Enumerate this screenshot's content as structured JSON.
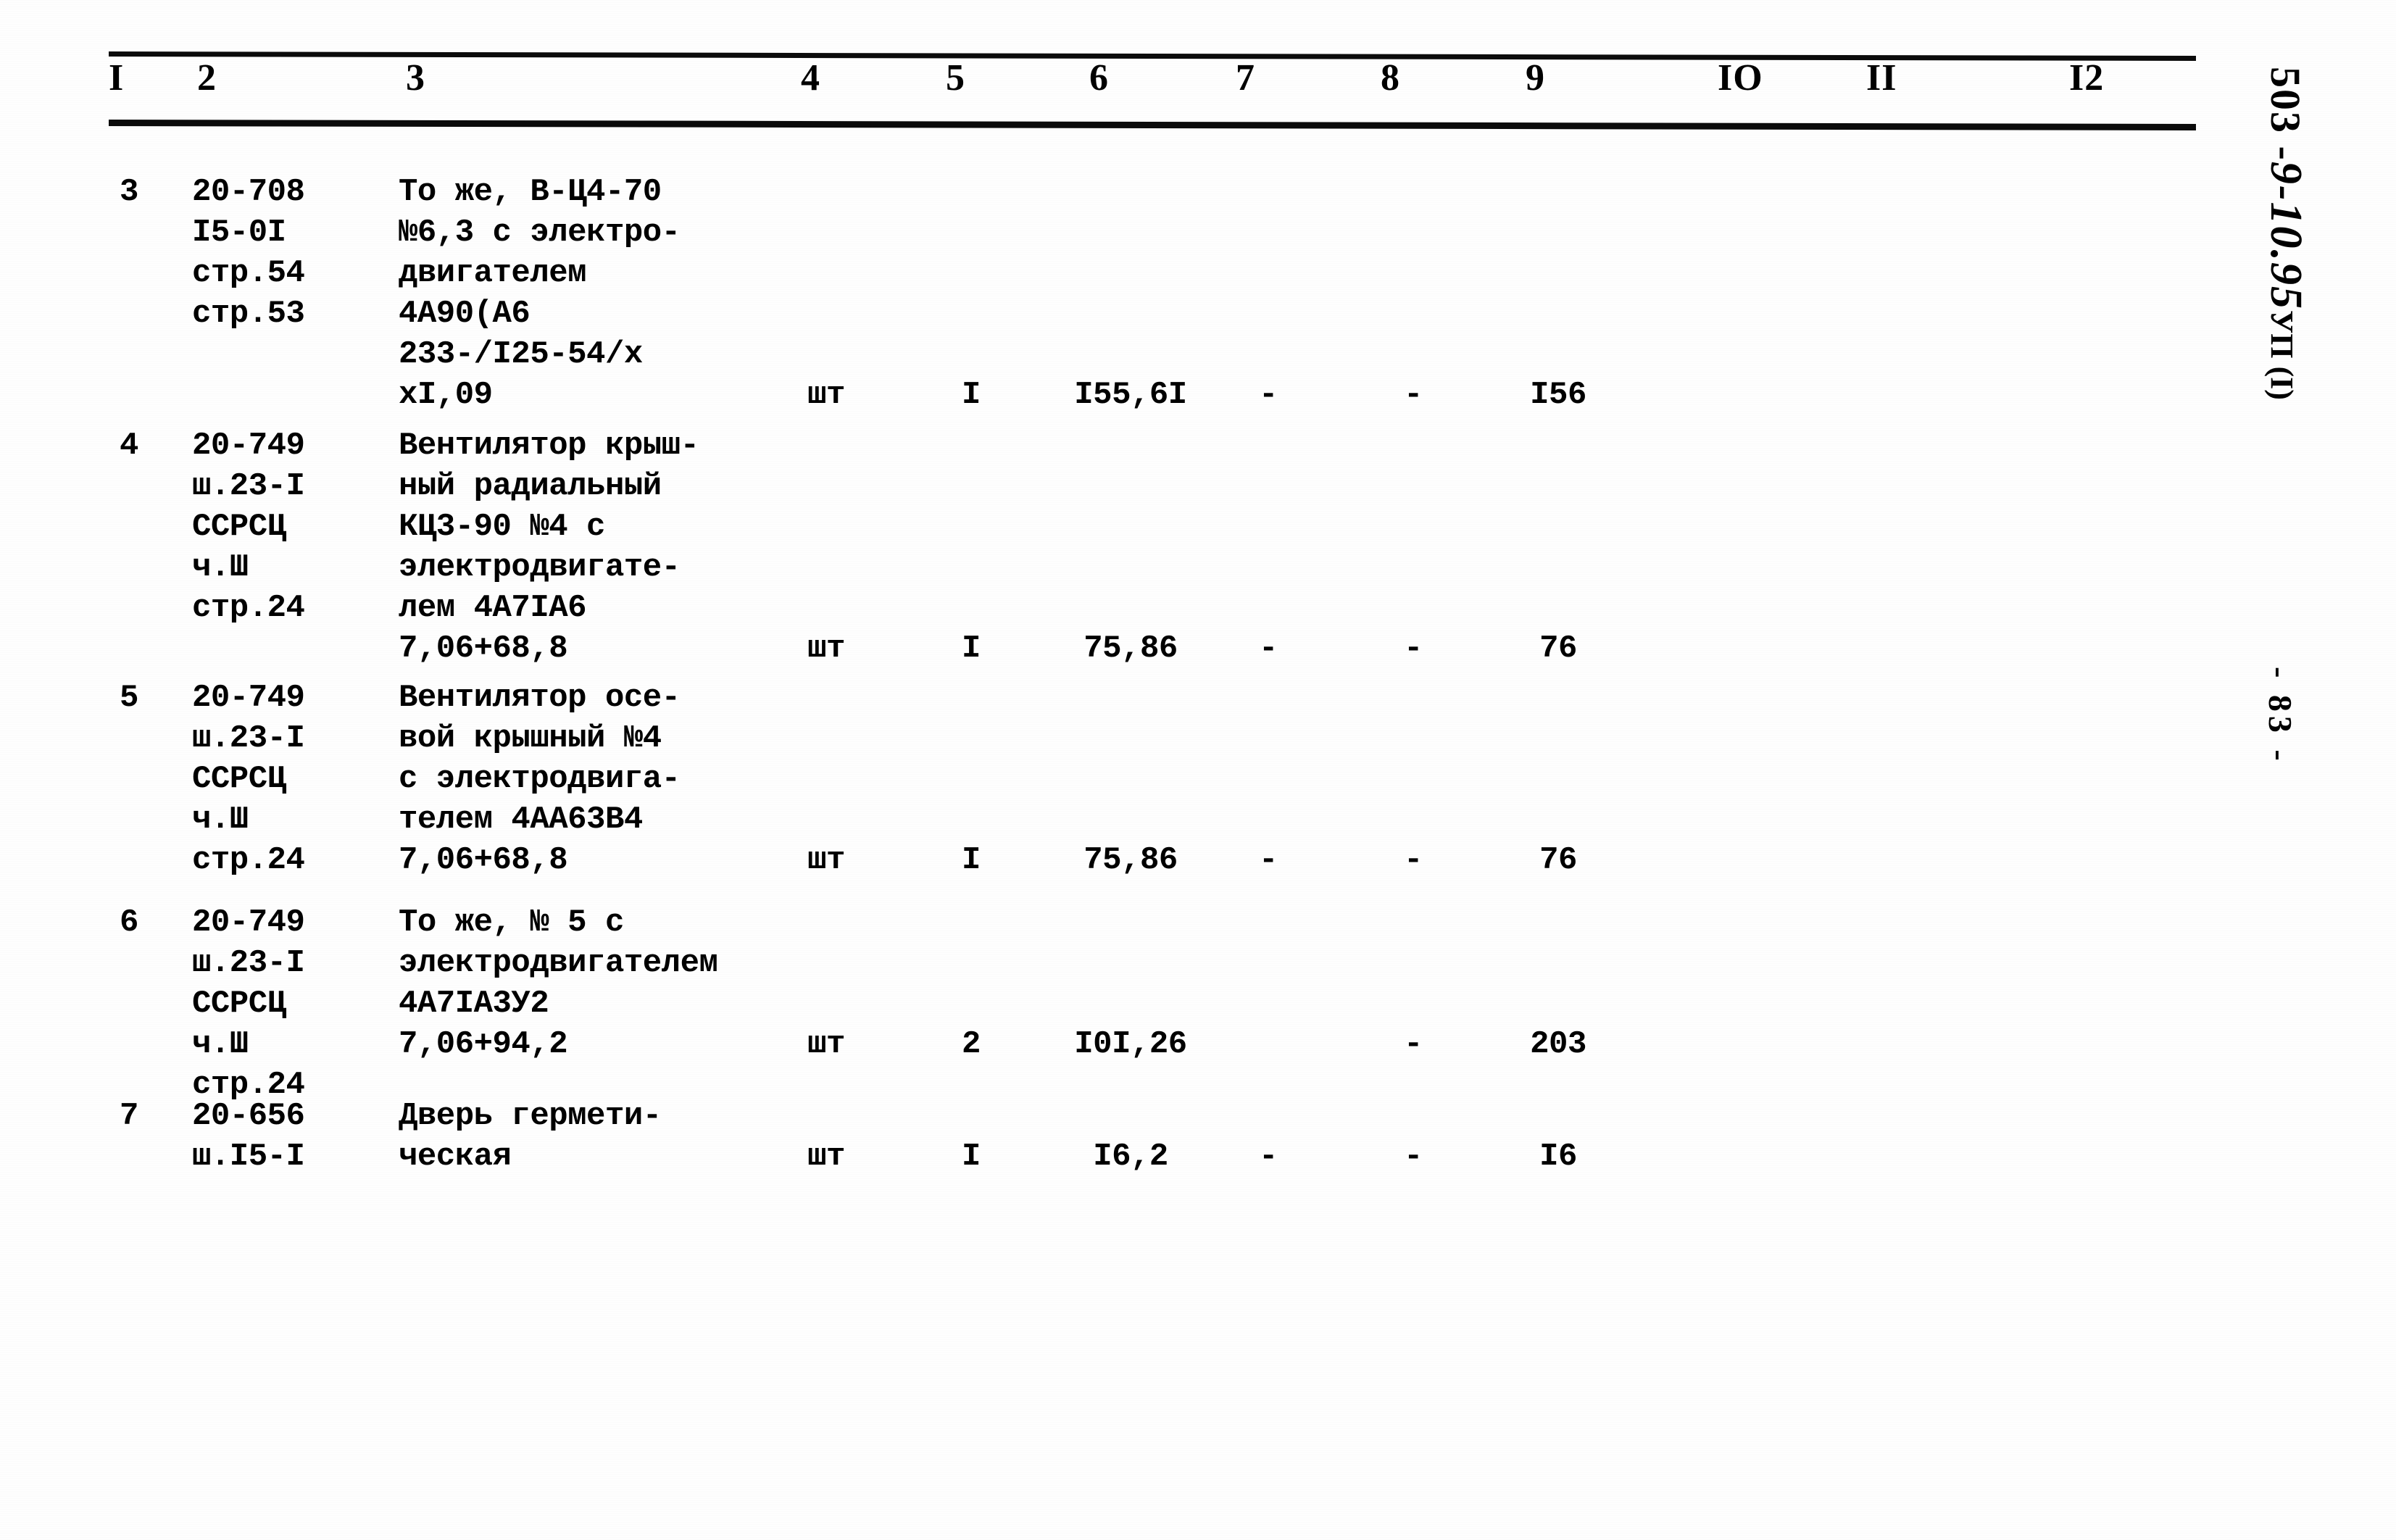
{
  "document": {
    "margin_code": "503 - 9-10.95 УП (I)",
    "margin_code_parts": {
      "prefix": "503 -",
      "italic": "9-10.95",
      "suffix": "УП (I)"
    },
    "page_marker": "- 83 -"
  },
  "table": {
    "column_headers": [
      "I",
      "2",
      "3",
      "4",
      "5",
      "6",
      "7",
      "8",
      "9",
      "IO",
      "II",
      "I2"
    ],
    "rows": [
      {
        "c1": "3",
        "c2": [
          "20-708",
          "I5-0I",
          "стр.54",
          "стр.53"
        ],
        "c3": [
          "То же, В-Ц4-70",
          "№6,3 с электро-",
          "двигателем",
          "4А90(А6",
          "233-/I25-54/х",
          "хI,09"
        ],
        "c4": "шт",
        "c5": "I",
        "c6": "I55,6I",
        "c7": "-",
        "c8": "-",
        "c9": "I56",
        "c10": "",
        "c11": "",
        "c12": "",
        "value_line_index": 5
      },
      {
        "c1": "4",
        "c2": [
          "20-749",
          "ш.23-I",
          "ССРСЦ",
          "ч.Ш",
          "стр.24"
        ],
        "c3": [
          "Вентилятор крыш-",
          "ный радиальный",
          "КЦ3-90 №4 с",
          "электродвигате-",
          "лем 4А7IА6",
          "7,06+68,8"
        ],
        "c4": "шт",
        "c5": "I",
        "c6": "75,86",
        "c7": "-",
        "c8": "-",
        "c9": "76",
        "c10": "",
        "c11": "",
        "c12": "",
        "value_line_index": 5
      },
      {
        "c1": "5",
        "c2": [
          "20-749",
          "ш.23-I",
          "ССРСЦ",
          "ч.Ш",
          "стр.24"
        ],
        "c3": [
          "Вентилятор осе-",
          "вой крышный №4",
          "с электродвига-",
          "телем 4АА63В4",
          "7,06+68,8"
        ],
        "c4": "шт",
        "c5": "I",
        "c6": "75,86",
        "c7": "-",
        "c8": "-",
        "c9": "76",
        "c10": "",
        "c11": "",
        "c12": "",
        "value_line_index": 4
      },
      {
        "c1": "6",
        "c2": [
          "20-749",
          "ш.23-I",
          "ССРСЦ",
          "ч.Ш",
          "стр.24"
        ],
        "c3": [
          "То же, № 5 с",
          "электродвигателем",
          "4А7IА3У2",
          "7,06+94,2"
        ],
        "c4": "шт",
        "c5": "2",
        "c6": "I0I,26",
        "c7": "",
        "c8": "-",
        "c9": "203",
        "c10": "",
        "c11": "",
        "c12": "",
        "value_line_index": 3
      },
      {
        "c1": "7",
        "c2": [
          "20-656",
          "ш.I5-I"
        ],
        "c3": [
          "Дверь гермети-",
          "ческая"
        ],
        "c4": "шт",
        "c5": "I",
        "c6": "I6,2",
        "c7": "-",
        "c8": "-",
        "c9": "I6",
        "c10": "",
        "c11": "",
        "c12": "",
        "value_line_index": 1
      }
    ]
  }
}
